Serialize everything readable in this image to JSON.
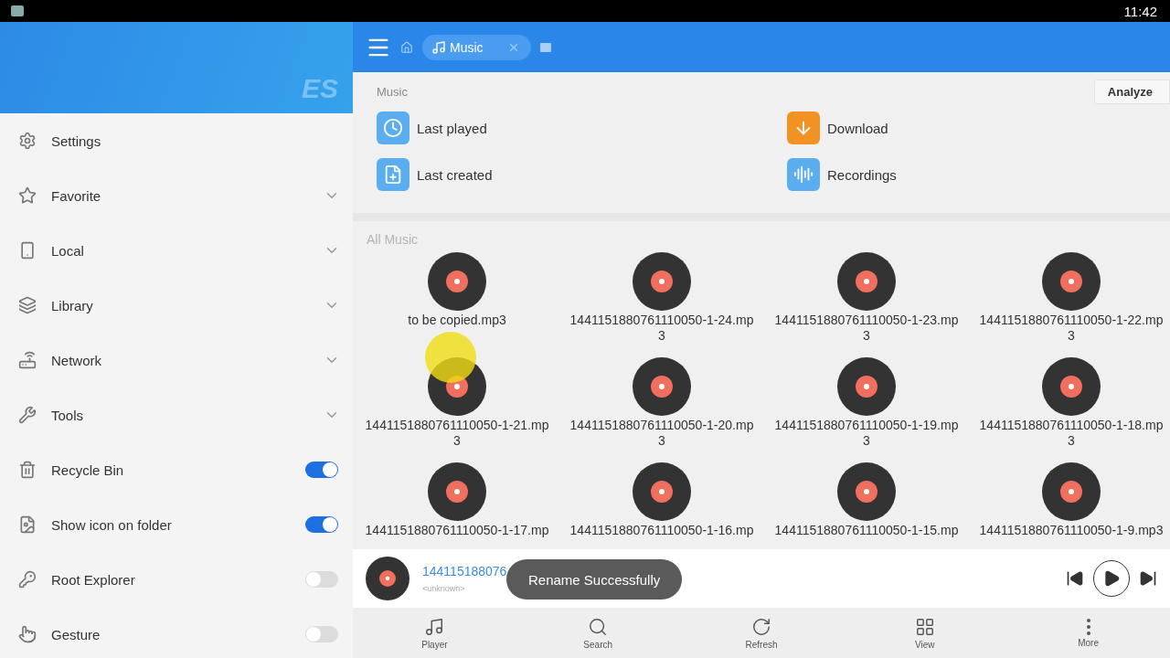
{
  "status_bar": {
    "time": "11:42"
  },
  "sidebar": {
    "logo": "ES",
    "items": [
      {
        "label": "Settings",
        "kind": "link"
      },
      {
        "label": "Favorite",
        "kind": "expandable",
        "expanded": false
      },
      {
        "label": "Local",
        "kind": "expandable",
        "expanded": false
      },
      {
        "label": "Library",
        "kind": "expandable",
        "expanded": false
      },
      {
        "label": "Network",
        "kind": "expandable",
        "expanded": false
      },
      {
        "label": "Tools",
        "kind": "expandable",
        "expanded": false
      },
      {
        "label": "Recycle Bin",
        "kind": "toggle",
        "on": true
      },
      {
        "label": "Show icon on folder",
        "kind": "toggle",
        "on": true
      },
      {
        "label": "Root Explorer",
        "kind": "toggle",
        "on": false
      },
      {
        "label": "Gesture",
        "kind": "toggle",
        "on": false
      }
    ]
  },
  "toolbar": {
    "tab": {
      "label": "Music"
    }
  },
  "music_section": {
    "title": "Music",
    "analyze_button": "Analyze",
    "shortcuts": [
      {
        "label": "Last played",
        "color": "#5aaef0"
      },
      {
        "label": "Download",
        "color": "#f39224"
      },
      {
        "label": "Last created",
        "color": "#5aaef0"
      },
      {
        "label": "Recordings",
        "color": "#5aaef0"
      }
    ]
  },
  "all_music": {
    "title": "All Music",
    "files": [
      {
        "name": "to be copied.mp3"
      },
      {
        "name": "1441151880761110050-1-24.mp3"
      },
      {
        "name": "1441151880761110050-1-23.mp3"
      },
      {
        "name": "1441151880761110050-1-22.mp3"
      },
      {
        "name": "1441151880761110050-1-21.mp3"
      },
      {
        "name": "1441151880761110050-1-20.mp3"
      },
      {
        "name": "1441151880761110050-1-19.mp3"
      },
      {
        "name": "1441151880761110050-1-18.mp3"
      },
      {
        "name": "1441151880761110050-1-17.mp"
      },
      {
        "name": "1441151880761110050-1-16.mp"
      },
      {
        "name": "1441151880761110050-1-15.mp"
      },
      {
        "name": "1441151880761110050-1-9.mp3"
      }
    ]
  },
  "player": {
    "title": "144115188076",
    "artist": "<unknown>",
    "playing": false
  },
  "toast": "Rename Successfully",
  "bottom_nav": [
    {
      "label": "Player"
    },
    {
      "label": "Search"
    },
    {
      "label": "Refresh"
    },
    {
      "label": "View"
    },
    {
      "label": "More"
    }
  ]
}
